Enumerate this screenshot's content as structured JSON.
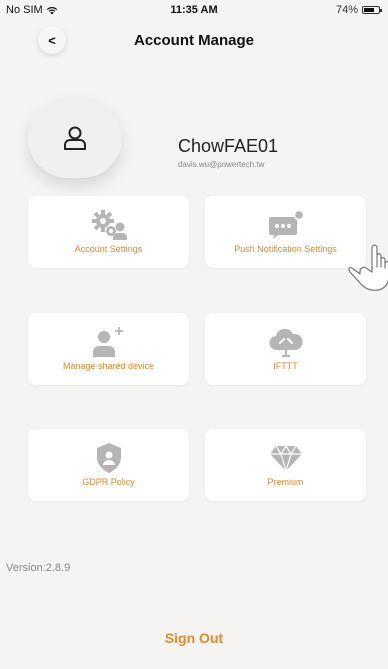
{
  "status_bar": {
    "carrier": "No SIM",
    "time": "11:35 AM",
    "battery": "74%",
    "battery_level": 0.74
  },
  "header": {
    "back_label": "<",
    "title": "Account Manage"
  },
  "profile": {
    "username": "ChowFAE01",
    "email": "davis.wu@powertech.tw"
  },
  "tiles": [
    {
      "label": "Account Settings",
      "icon": "gears-user-icon"
    },
    {
      "label": "Push Notification Settings",
      "icon": "chat-notification-icon"
    },
    {
      "label": "Manage shared device",
      "icon": "add-user-icon"
    },
    {
      "label": "IFTTT",
      "icon": "cloud-link-icon"
    },
    {
      "label": "GDPR Policy",
      "icon": "shield-user-icon"
    },
    {
      "label": "Premium",
      "icon": "diamond-icon"
    }
  ],
  "footer": {
    "version": "Version:2.8.9",
    "sign_out": "Sign Out"
  },
  "colors": {
    "accent": "#e38a24",
    "icon_gray": "#b5b5b5",
    "background": "#f5f4f3"
  }
}
